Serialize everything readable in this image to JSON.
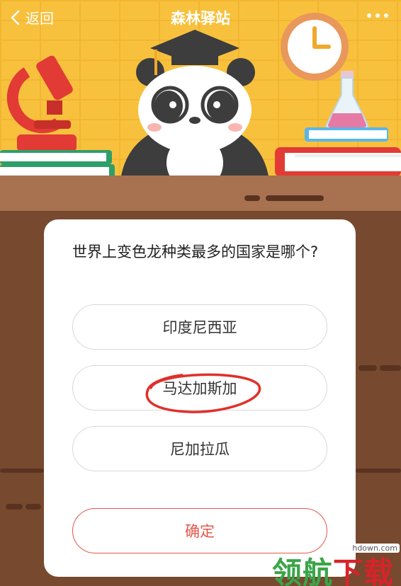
{
  "header": {
    "back_label": "返回",
    "title": "森林驿站",
    "more_icon": "more-dots-icon"
  },
  "quiz": {
    "question": "世界上变色龙种类最多的国家是哪个?",
    "options": [
      {
        "label": "印度尼西亚",
        "marked": false
      },
      {
        "label": "马达加斯加",
        "marked": true
      },
      {
        "label": "尼加拉瓜",
        "marked": false
      }
    ],
    "confirm_label": "确定",
    "accent_color": "#e4574a"
  },
  "watermark": {
    "url": "hdown.com",
    "text_part1": "领航",
    "text_part2": "下载"
  }
}
